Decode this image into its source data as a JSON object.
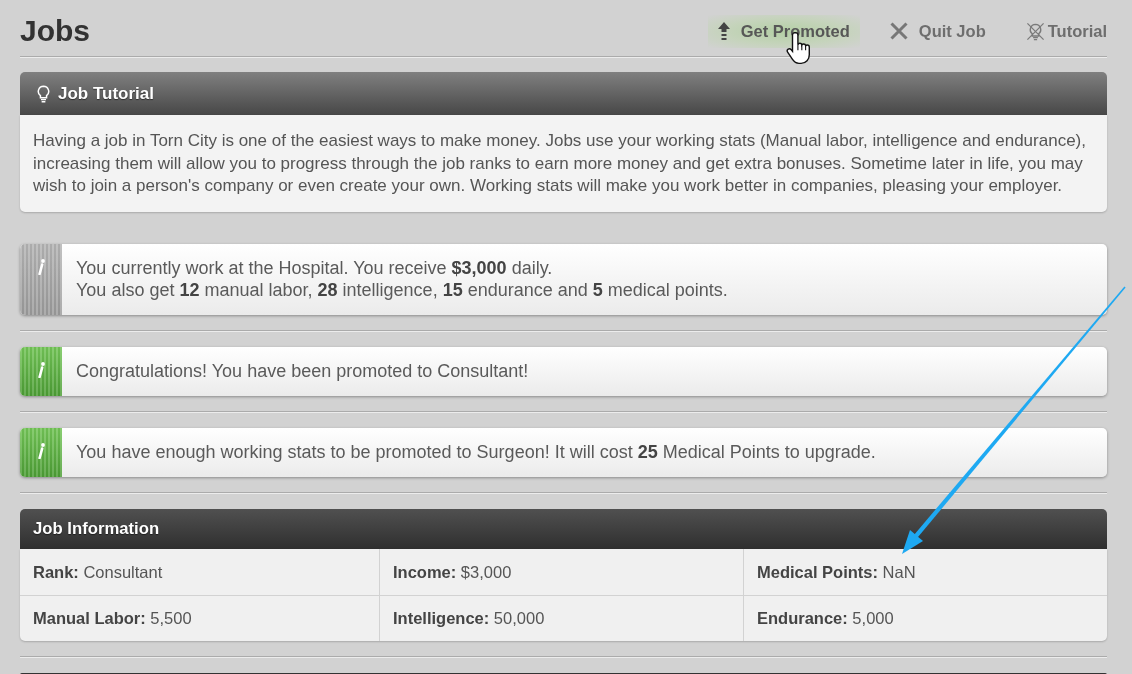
{
  "page": {
    "title": "Jobs"
  },
  "actions": [
    {
      "kind": "promote",
      "label": "Get Promoted",
      "highlighted": true
    },
    {
      "kind": "quit",
      "label": "Quit Job",
      "highlighted": false
    },
    {
      "kind": "tutorial",
      "label": "Tutorial",
      "highlighted": false
    }
  ],
  "tutorial": {
    "title": "Job Tutorial",
    "text": "Having a job in Torn City is one of the easiest ways to make money. Jobs use your working stats (Manual labor, intelligence and endurance), increasing them will allow you to progress through the job ranks to earn more money and get extra bonuses. Sometime later in life, you may wish to join a person's company or even create your own. Working stats will make you work better in companies, pleasing your employer."
  },
  "messages": [
    {
      "kind": "info",
      "lines": [
        "You currently work at the Hospital. You receive **$3,000** daily.",
        "You also get **12** manual labor, **28** intelligence, **15** endurance and **5** medical points."
      ]
    },
    {
      "kind": "success",
      "lines": [
        "Congratulations! You have been promoted to Consultant!"
      ]
    },
    {
      "kind": "success",
      "lines": [
        "You have enough working stats to be promoted to Surgeon! It will cost **25** Medical Points to upgrade."
      ]
    }
  ],
  "job_information": {
    "title": "Job Information",
    "rows": [
      [
        "**Rank:** Consultant",
        "**Income:** $3,000",
        "**Medical Points:** NaN"
      ],
      [
        "**Manual Labor:** 5,500",
        "**Intelligence:** 50,000",
        "**Endurance:** 5,000"
      ]
    ]
  }
}
